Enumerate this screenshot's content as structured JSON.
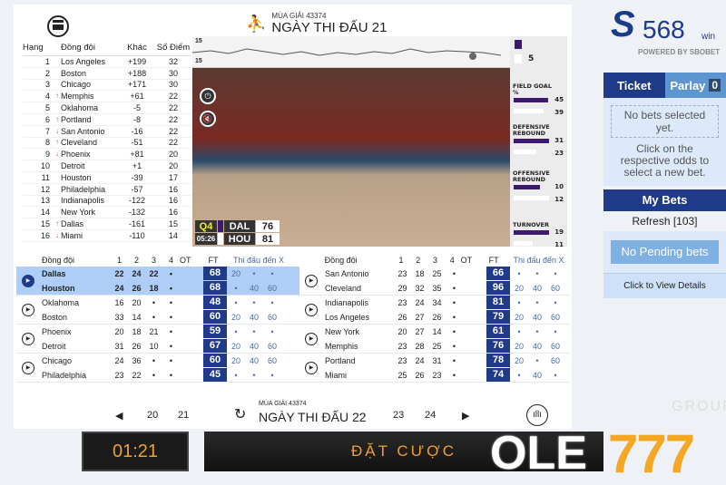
{
  "header": {
    "season": "MÙA GIẢI 43374",
    "matchday": "NGÀY THI ĐẤU 21"
  },
  "standings": {
    "headers": [
      "Hạng",
      "Đồng đội",
      "Khác",
      "Số Điểm"
    ],
    "rows": [
      {
        "rank": "1",
        "trend": "",
        "team": "Los Angeles",
        "diff": "+199",
        "pts": "32"
      },
      {
        "rank": "2",
        "trend": "",
        "team": "Boston",
        "diff": "+188",
        "pts": "30"
      },
      {
        "rank": "3",
        "trend": "",
        "team": "Chicago",
        "diff": "+171",
        "pts": "30"
      },
      {
        "rank": "4",
        "trend": "up",
        "team": "Memphis",
        "diff": "+61",
        "pts": "22"
      },
      {
        "rank": "5",
        "trend": "",
        "team": "Oklahoma",
        "diff": "-5",
        "pts": "22"
      },
      {
        "rank": "6",
        "trend": "up",
        "team": "Portland",
        "diff": "-8",
        "pts": "22"
      },
      {
        "rank": "7",
        "trend": "down",
        "team": "San Antonio",
        "diff": "-16",
        "pts": "22"
      },
      {
        "rank": "8",
        "trend": "up",
        "team": "Cleveland",
        "diff": "-51",
        "pts": "22"
      },
      {
        "rank": "9",
        "trend": "down",
        "team": "Phoenix",
        "diff": "+81",
        "pts": "20"
      },
      {
        "rank": "10",
        "trend": "",
        "team": "Detroit",
        "diff": "+1",
        "pts": "20"
      },
      {
        "rank": "11",
        "trend": "",
        "team": "Houston",
        "diff": "-39",
        "pts": "17"
      },
      {
        "rank": "12",
        "trend": "",
        "team": "Philadelphia",
        "diff": "-57",
        "pts": "16"
      },
      {
        "rank": "13",
        "trend": "",
        "team": "Indianapolis",
        "diff": "-122",
        "pts": "16"
      },
      {
        "rank": "14",
        "trend": "",
        "team": "New York",
        "diff": "-132",
        "pts": "16"
      },
      {
        "rank": "15",
        "trend": "up",
        "team": "Dallas",
        "diff": "-161",
        "pts": "15"
      },
      {
        "rank": "16",
        "trend": "down",
        "team": "Miami",
        "diff": "-110",
        "pts": "14"
      }
    ]
  },
  "video": {
    "chart_top": "15",
    "chart_bottom": "15",
    "legend_value": "5",
    "quarter": "Q4",
    "clock": "05:26",
    "home": "DAL",
    "home_score": "76",
    "away": "HOU",
    "away_score": "81",
    "stats": [
      {
        "label": "FIELD GOAL %",
        "a": "45",
        "b": "39",
        "fa": 0.9,
        "fb": 0.78
      },
      {
        "label": "DEFENSIVE REBOUND",
        "a": "31",
        "b": "23",
        "fa": 0.92,
        "fb": 0.6
      },
      {
        "label": "OFFENSIVE REBOUND",
        "a": "10",
        "b": "12",
        "fa": 0.7,
        "fb": 0.92
      },
      {
        "label": "TURNOVER",
        "a": "19",
        "b": "11",
        "fa": 0.92,
        "fb": 0.5
      }
    ],
    "colors": {
      "team_a": "#3d1a6e",
      "team_b": "#ffffff"
    }
  },
  "games": {
    "headers": [
      "Đồng đội",
      "1",
      "2",
      "3",
      "4",
      "OT",
      "FT",
      "Thi đấu đến X"
    ],
    "left": [
      {
        "active": true,
        "teams": [
          {
            "name": "Dallas",
            "q": [
              "22",
              "24",
              "22",
              "•"
            ],
            "ft": "68",
            "x": [
              "20",
              "•",
              "•"
            ]
          },
          {
            "name": "Houston",
            "q": [
              "24",
              "26",
              "18",
              "•"
            ],
            "ft": "68",
            "x": [
              "•",
              "40",
              "60"
            ]
          }
        ]
      },
      {
        "teams": [
          {
            "name": "Oklahoma",
            "q": [
              "16",
              "20",
              "•",
              "•"
            ],
            "ft": "48",
            "x": [
              "•",
              "•",
              "•"
            ]
          },
          {
            "name": "Boston",
            "q": [
              "33",
              "14",
              "•",
              "•"
            ],
            "ft": "60",
            "x": [
              "20",
              "40",
              "60"
            ]
          }
        ]
      },
      {
        "teams": [
          {
            "name": "Phoenix",
            "q": [
              "20",
              "18",
              "21",
              "•"
            ],
            "ft": "59",
            "x": [
              "•",
              "•",
              "•"
            ]
          },
          {
            "name": "Detroit",
            "q": [
              "31",
              "26",
              "10",
              "•"
            ],
            "ft": "67",
            "x": [
              "20",
              "40",
              "60"
            ]
          }
        ]
      },
      {
        "teams": [
          {
            "name": "Chicago",
            "q": [
              "24",
              "36",
              "•",
              "•"
            ],
            "ft": "60",
            "x": [
              "20",
              "40",
              "60"
            ]
          },
          {
            "name": "Philadelphia",
            "q": [
              "23",
              "22",
              "•",
              "•"
            ],
            "ft": "45",
            "x": [
              "•",
              "•",
              "•"
            ]
          }
        ]
      }
    ],
    "right": [
      {
        "teams": [
          {
            "name": "San Antonio",
            "q": [
              "23",
              "18",
              "25",
              "•"
            ],
            "ft": "66",
            "x": [
              "•",
              "•",
              "•"
            ]
          },
          {
            "name": "Cleveland",
            "q": [
              "29",
              "32",
              "35",
              "•"
            ],
            "ft": "96",
            "x": [
              "20",
              "40",
              "60"
            ]
          }
        ]
      },
      {
        "teams": [
          {
            "name": "Indianapolis",
            "q": [
              "23",
              "24",
              "34",
              "•"
            ],
            "ft": "81",
            "x": [
              "•",
              "•",
              "•"
            ]
          },
          {
            "name": "Los Angeles",
            "q": [
              "26",
              "27",
              "26",
              "•"
            ],
            "ft": "79",
            "x": [
              "20",
              "40",
              "60"
            ]
          }
        ]
      },
      {
        "teams": [
          {
            "name": "New York",
            "q": [
              "20",
              "27",
              "14",
              "•"
            ],
            "ft": "61",
            "x": [
              "•",
              "•",
              "•"
            ]
          },
          {
            "name": "Memphis",
            "q": [
              "23",
              "28",
              "25",
              "•"
            ],
            "ft": "76",
            "x": [
              "20",
              "40",
              "60"
            ]
          }
        ]
      },
      {
        "teams": [
          {
            "name": "Portland",
            "q": [
              "23",
              "24",
              "31",
              "•"
            ],
            "ft": "78",
            "x": [
              "20",
              "•",
              "60"
            ]
          },
          {
            "name": "Miami",
            "q": [
              "25",
              "26",
              "23",
              "•"
            ],
            "ft": "74",
            "x": [
              "•",
              "40",
              "•"
            ]
          }
        ]
      }
    ]
  },
  "nav": {
    "prev": [
      "20",
      "21"
    ],
    "next": [
      "23",
      "24"
    ],
    "season": "MÙA GIẢI 43374",
    "matchday": "NGÀY THI ĐẤU 22"
  },
  "bottom": {
    "timer": "01:21",
    "bet_label": "ĐẶT CƯỢC"
  },
  "brand": {
    "logo_text": "568",
    "logo_suffix": "win",
    "powered": "POWERED BY SBOBET",
    "watermark": "OLE777",
    "watermark_group": "GROUP"
  },
  "sidebar": {
    "tab_ticket": "Ticket",
    "tab_parlay": "Parlay",
    "parlay_count": "0",
    "no_bets": "No bets selected yet.",
    "hint": "Click on the respective odds to select a new bet.",
    "my_bets": "My Bets",
    "refresh": "Refresh [103]",
    "no_pending": "No Pending bets",
    "view_details": "Click to View Details"
  }
}
